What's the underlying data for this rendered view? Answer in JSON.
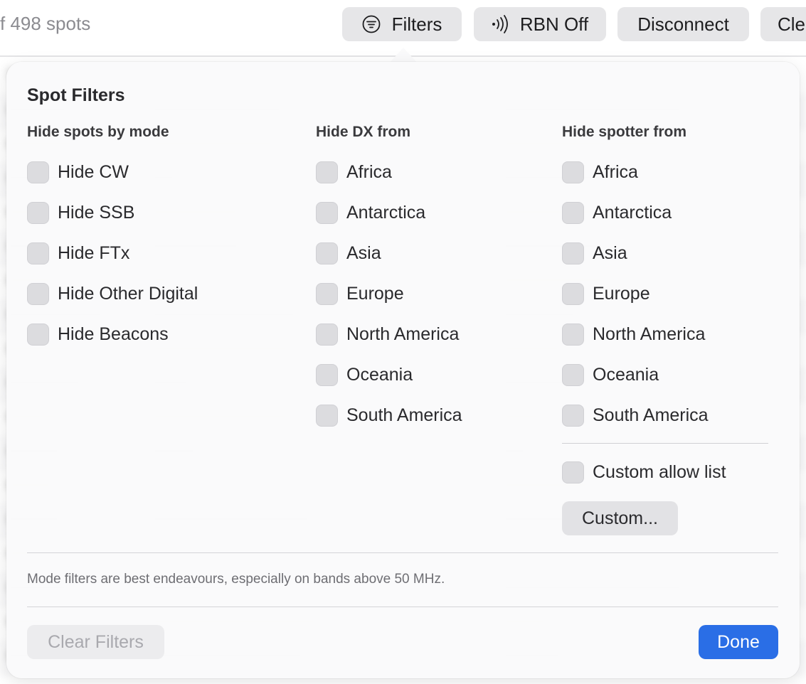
{
  "toolbar": {
    "spot_count": "f 498 spots",
    "filters_label": "Filters",
    "filters_icon": "filter-lines-icon",
    "rbn_label": "RBN Off",
    "rbn_icon": "signal-waves-icon",
    "disconnect_label": "Disconnect",
    "clear_label": "Cle"
  },
  "popover": {
    "title": "Spot Filters",
    "mode_column": {
      "title": "Hide spots by mode",
      "items": [
        {
          "label": "Hide CW",
          "checked": false
        },
        {
          "label": "Hide SSB",
          "checked": false
        },
        {
          "label": "Hide FTx",
          "checked": false
        },
        {
          "label": "Hide Other Digital",
          "checked": false
        },
        {
          "label": "Hide Beacons",
          "checked": false
        }
      ]
    },
    "dx_column": {
      "title": "Hide DX from",
      "items": [
        {
          "label": "Africa",
          "checked": false
        },
        {
          "label": "Antarctica",
          "checked": false
        },
        {
          "label": "Asia",
          "checked": false
        },
        {
          "label": "Europe",
          "checked": false
        },
        {
          "label": "North America",
          "checked": false
        },
        {
          "label": "Oceania",
          "checked": false
        },
        {
          "label": "South America",
          "checked": false
        }
      ]
    },
    "spotter_column": {
      "title": "Hide spotter from",
      "items": [
        {
          "label": "Africa",
          "checked": false
        },
        {
          "label": "Antarctica",
          "checked": false
        },
        {
          "label": "Asia",
          "checked": false
        },
        {
          "label": "Europe",
          "checked": false
        },
        {
          "label": "North America",
          "checked": false
        },
        {
          "label": "Oceania",
          "checked": false
        },
        {
          "label": "South America",
          "checked": false
        }
      ]
    },
    "custom_allow_label": "Custom allow list",
    "custom_allow_checked": false,
    "custom_button_label": "Custom...",
    "footnote": "Mode filters are best endeavours, especially on bands above 50 MHz.",
    "clear_filters_label": "Clear Filters",
    "done_label": "Done",
    "colors": {
      "accent": "#2a6ee6",
      "disabled_text": "#a9a9ae"
    }
  }
}
